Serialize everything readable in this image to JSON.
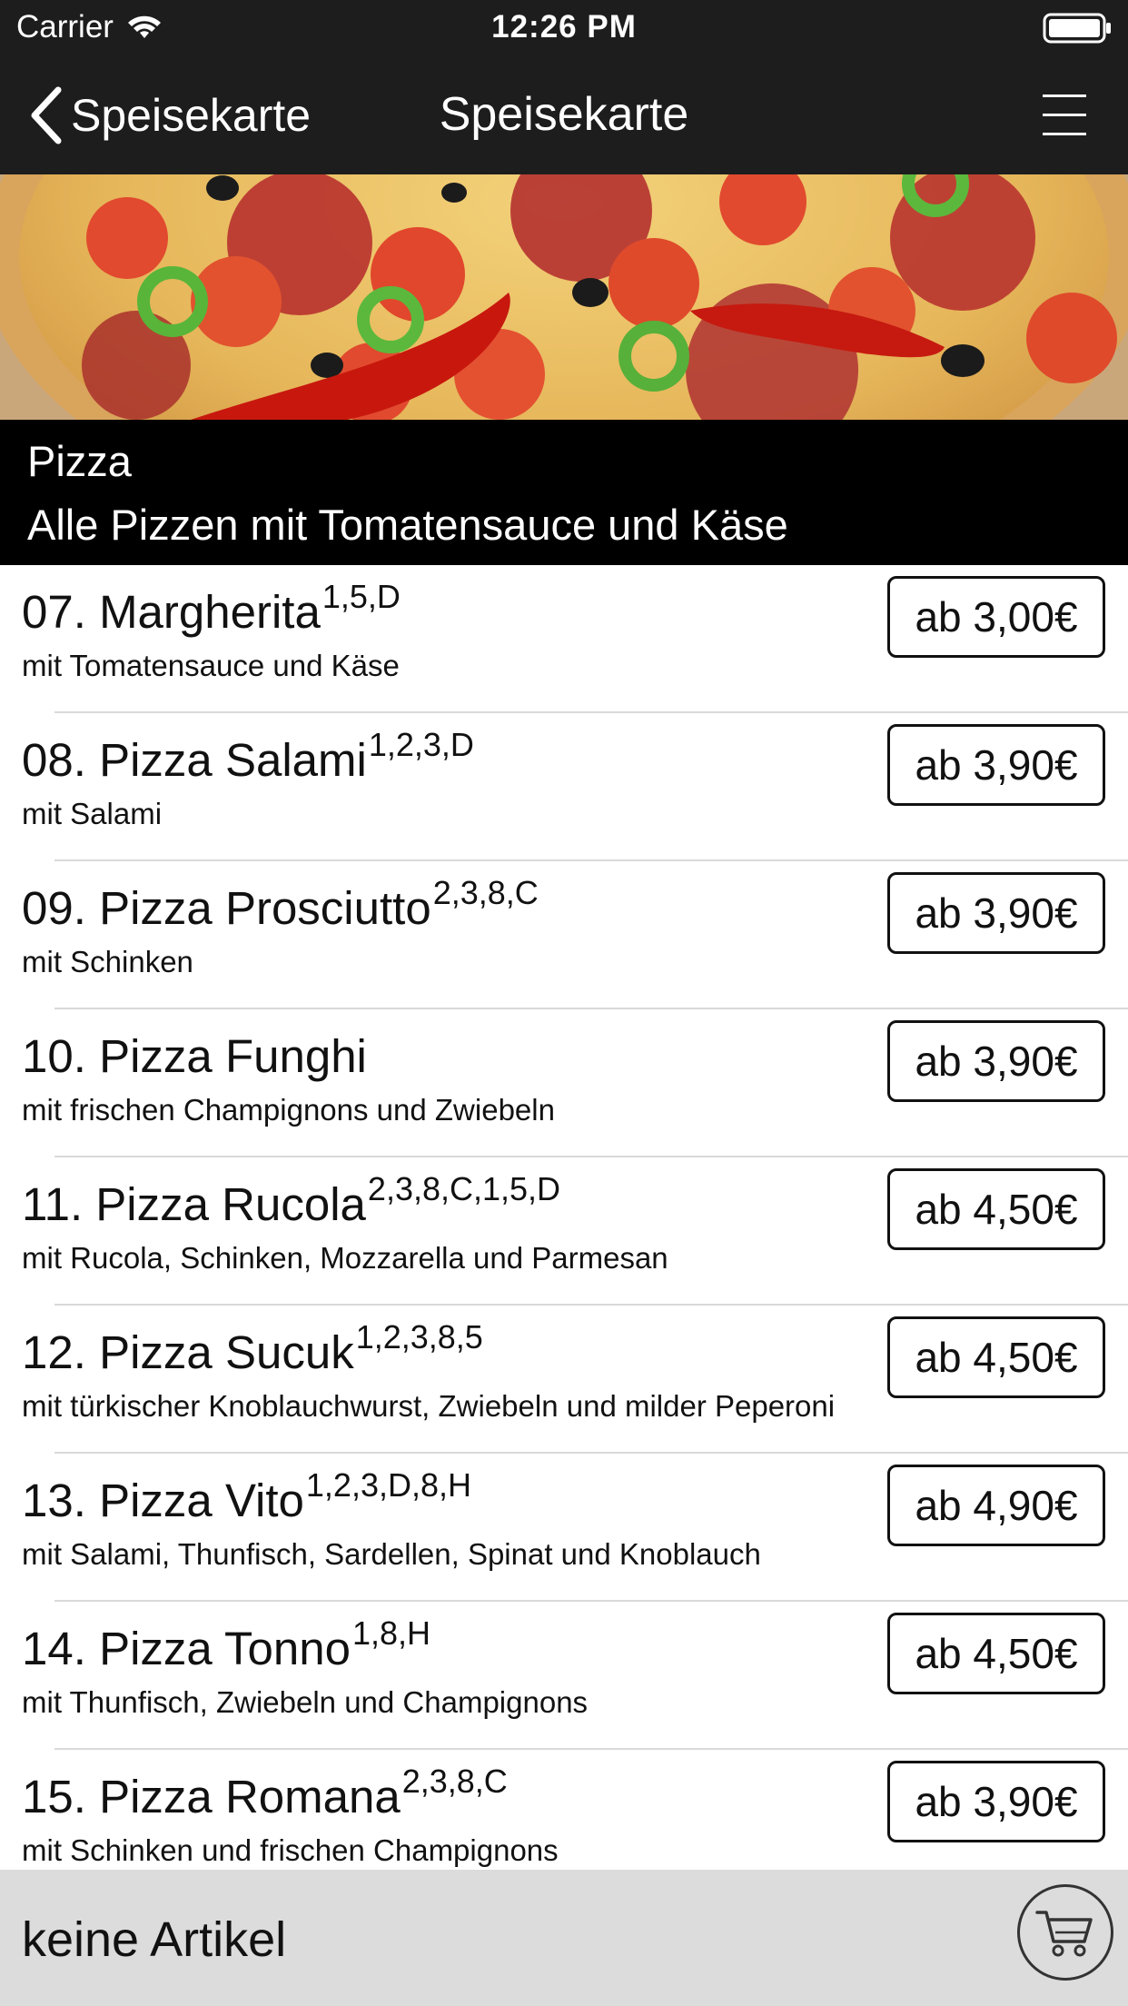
{
  "status_bar": {
    "carrier": "Carrier",
    "time": "12:26 PM"
  },
  "nav": {
    "back_label": "Speisekarte",
    "title": "Speisekarte"
  },
  "category": {
    "name": "Pizza",
    "description": "Alle Pizzen mit Tomatensauce und Käse"
  },
  "items": [
    {
      "name": "07. Margherita",
      "allergens": "1,5,D",
      "description": "mit Tomatensauce und Käse",
      "price": "ab 3,00€"
    },
    {
      "name": "08. Pizza Salami",
      "allergens": "1,2,3,D",
      "description": "mit Salami",
      "price": "ab 3,90€"
    },
    {
      "name": "09. Pizza Prosciutto",
      "allergens": "2,3,8,C",
      "description": "mit Schinken",
      "price": "ab 3,90€"
    },
    {
      "name": "10. Pizza Funghi",
      "allergens": "",
      "description": "mit frischen Champignons und Zwiebeln",
      "price": "ab 3,90€"
    },
    {
      "name": "11. Pizza Rucola",
      "allergens": "2,3,8,C,1,5,D",
      "description": "mit Rucola, Schinken, Mozzarella und Parmesan",
      "price": "ab 4,50€"
    },
    {
      "name": "12. Pizza Sucuk",
      "allergens": "1,2,3,8,5",
      "description": "mit türkischer Knoblauchwurst, Zwiebeln und milder Peperoni",
      "price": "ab 4,50€"
    },
    {
      "name": "13. Pizza Vito",
      "allergens": "1,2,3,D,8,H",
      "description": "mit Salami, Thunfisch, Sardellen, Spinat und Knoblauch",
      "price": "ab 4,90€"
    },
    {
      "name": "14. Pizza Tonno",
      "allergens": "1,8,H",
      "description": "mit Thunfisch, Zwiebeln und Champignons",
      "price": "ab 4,50€"
    },
    {
      "name": "15. Pizza Romana",
      "allergens": "2,3,8,C",
      "description": "mit Schinken und frischen Champignons",
      "price": "ab 3,90€"
    }
  ],
  "cart": {
    "label": "keine Artikel",
    "icon": "shopping-cart-icon"
  },
  "icons": {
    "back": "chevron-left-icon",
    "menu": "hamburger-menu-icon",
    "wifi": "wifi-icon",
    "battery": "battery-icon"
  },
  "colors": {
    "bar_background": "#1d1d1d",
    "category_background": "#000000",
    "cart_bar_background": "#dcdcdc"
  }
}
